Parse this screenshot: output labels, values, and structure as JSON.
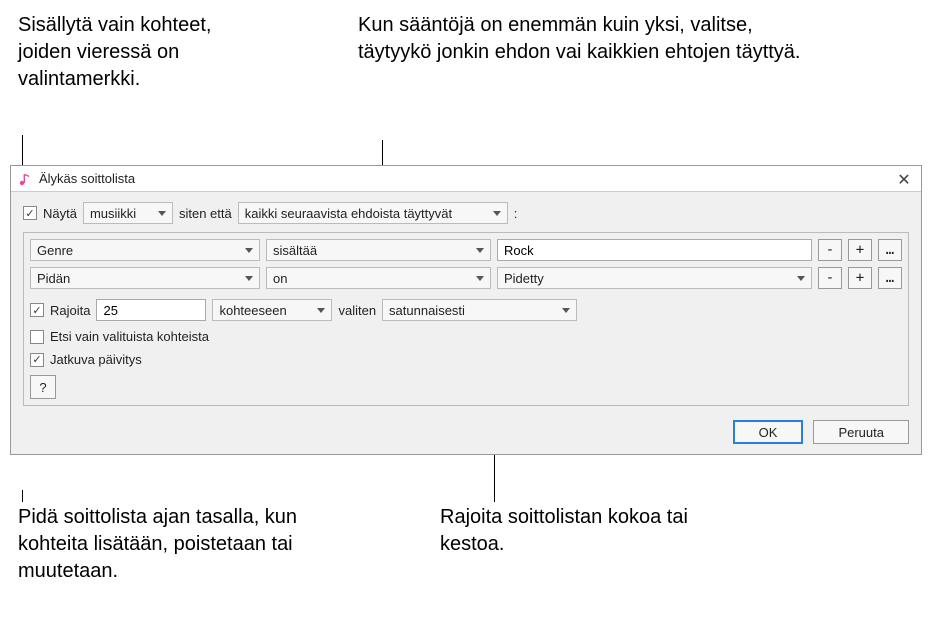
{
  "callouts": {
    "topLeft": "Sisällytä vain kohteet, joiden vieressä on valintamerkki.",
    "topRight": "Kun sääntöjä on enemmän kuin yksi, valitse, täytyykö jonkin ehdon vai kaikkien ehtojen täyttyä.",
    "bottomLeft": "Pidä soittolista ajan tasalla, kun kohteita lisätään, poistetaan tai muutetaan.",
    "bottomRight": "Rajoita soittolistan kokoa tai kestoa."
  },
  "window": {
    "title": "Älykäs soittolista"
  },
  "match": {
    "showLabel": "Näytä",
    "mediaType": "musiikki",
    "sitenEtta": "siten että",
    "condition": "kaikki seuraavista ehdoista täyttyvät",
    "colon": ":"
  },
  "rules": [
    {
      "field": "Genre",
      "op": "sisältää",
      "value": "Rock",
      "valueType": "text"
    },
    {
      "field": "Pidän",
      "op": "on",
      "value": "Pidetty",
      "valueType": "select"
    }
  ],
  "limit": {
    "label": "Rajoita",
    "value": "25",
    "unit": "kohteeseen",
    "valitsen": "valiten",
    "order": "satunnaisesti"
  },
  "checkedOnly": {
    "label": "Etsi vain valituista kohteista"
  },
  "liveUpdating": {
    "label": "Jatkuva päivitys"
  },
  "buttons": {
    "ok": "OK",
    "cancel": "Peruuta",
    "help": "?",
    "minus": "-",
    "plus": "+",
    "dots": "…"
  },
  "icons": {
    "close": "✕"
  }
}
